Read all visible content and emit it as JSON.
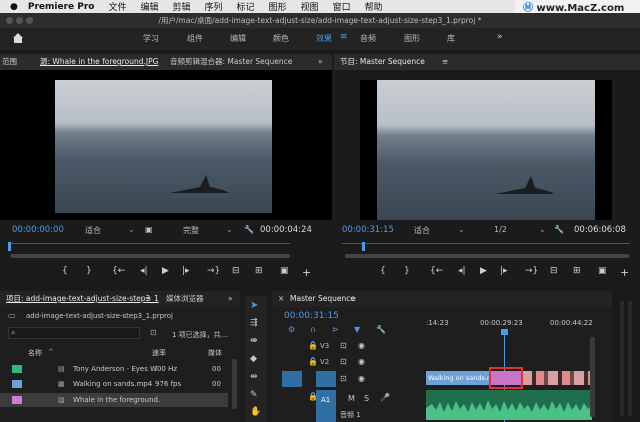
{
  "menubar": {
    "app": "Premiere Pro",
    "items": [
      "文件",
      "编辑",
      "剪辑",
      "序列",
      "标记",
      "图形",
      "视图",
      "窗口",
      "帮助"
    ]
  },
  "titlebar": {
    "path": "/用户/mac/桌面/add-image-text-adjust-size/add-image-text-adjust-size-step3_1.prproj *"
  },
  "workspace": {
    "tabs": [
      "学习",
      "组件",
      "编辑",
      "颜色",
      "效果",
      "音频",
      "图形",
      "库"
    ],
    "active": "效果"
  },
  "source_panel": {
    "left_fragment": "范围",
    "tab": "源: Whale in the foreground.JPG",
    "tab2": "音频剪辑混合器: Master Sequence",
    "timecode_in": "00:00:00:00",
    "fit": "适合",
    "quality": "完整",
    "timecode_dur": "00:00:04:24"
  },
  "program_panel": {
    "tab": "节目: Master Sequence",
    "timecode": "00:00:31:15",
    "fit": "适合",
    "quality": "1/2",
    "timecode_dur": "00:06:06:08"
  },
  "project_panel": {
    "tab": "项目: add-image-text-adjust-size-step3_1",
    "tab2": "媒体浏览器",
    "file": "add-image-text-adjust-size-step3_1.prproj",
    "status": "1 项已选择，共…",
    "col_name": "名称",
    "col_rate": "速率",
    "col_media": "媒体",
    "items": [
      {
        "name": "Tony Anderson - Eyes W",
        "rate": "l00 Hz",
        "media": "00",
        "color": "#2fb87a"
      },
      {
        "name": "Walking on sands.mp4",
        "rate": "976 fps",
        "media": "00",
        "color": "#6ea0d8"
      },
      {
        "name": "Whale in the foreground.",
        "rate": "",
        "media": "",
        "color": "#d27ad4"
      }
    ]
  },
  "timeline": {
    "tab": "Master Sequence",
    "timecode": "00:00:31:15",
    "ruler": [
      ":14:23",
      "00:00:29:23",
      "00:00:44:22"
    ],
    "tracks": [
      "V3",
      "V2",
      "V1",
      "A1"
    ],
    "a1_sub": "音频 1",
    "clip_label": "Walking on sands.mp4",
    "fx": "fx"
  },
  "watermark": "www.MacZ.com",
  "colors": {
    "accent": "#4d9be6",
    "highlight": "#e0332f",
    "bg": "#1b1b1b"
  }
}
